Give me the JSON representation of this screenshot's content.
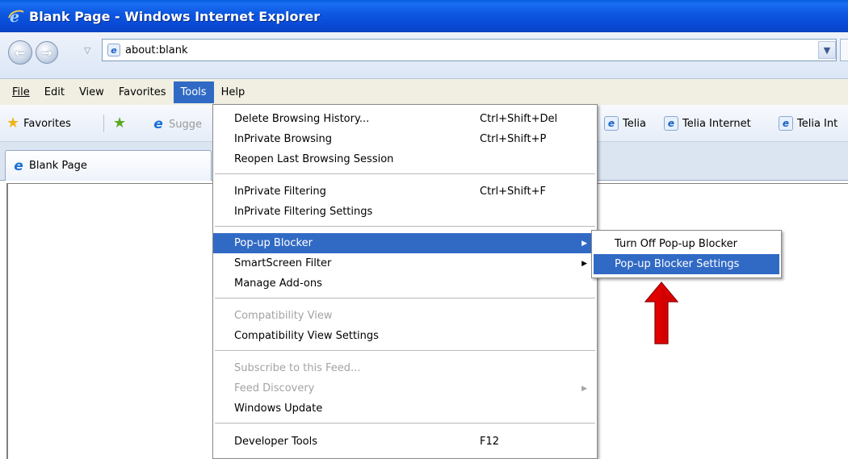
{
  "window": {
    "title": "Blank Page - Windows Internet Explorer"
  },
  "address": {
    "url": "about:blank"
  },
  "menubar": [
    "File",
    "Edit",
    "View",
    "Favorites",
    "Tools",
    "Help"
  ],
  "favorites_bar": {
    "favorites_label": "Favorites",
    "suggested_label": "Sugge",
    "links": [
      "Telia",
      "Telia Internet",
      "Telia Int"
    ]
  },
  "tab": {
    "label": "Blank Page"
  },
  "tools_menu": {
    "items": [
      {
        "label": "Delete Browsing History...",
        "shortcut": "Ctrl+Shift+Del"
      },
      {
        "label": "InPrivate Browsing",
        "shortcut": "Ctrl+Shift+P"
      },
      {
        "label": "Reopen Last Browsing Session",
        "shortcut": ""
      },
      {
        "label": "InPrivate Filtering",
        "shortcut": "Ctrl+Shift+F"
      },
      {
        "label": "InPrivate Filtering Settings",
        "shortcut": ""
      },
      {
        "label": "Pop-up Blocker",
        "shortcut": "",
        "highlighted": true,
        "submenu": true
      },
      {
        "label": "SmartScreen Filter",
        "shortcut": "",
        "submenu": true
      },
      {
        "label": "Manage Add-ons",
        "shortcut": ""
      },
      {
        "label": "Compatibility View",
        "shortcut": "",
        "disabled": true
      },
      {
        "label": "Compatibility View Settings",
        "shortcut": ""
      },
      {
        "label": "Subscribe to this Feed...",
        "shortcut": "",
        "disabled": true
      },
      {
        "label": "Feed Discovery",
        "shortcut": "",
        "disabled": true,
        "submenu": true
      },
      {
        "label": "Windows Update",
        "shortcut": ""
      },
      {
        "label": "Developer Tools",
        "shortcut": "F12"
      }
    ]
  },
  "popup_submenu": {
    "items": [
      {
        "label": "Turn Off Pop-up Blocker"
      },
      {
        "label": "Pop-up Blocker Settings",
        "highlighted": true
      }
    ]
  },
  "colors": {
    "highlight": "#316ac5",
    "titlebar": "#0a56e0",
    "arrow": "#e00000"
  }
}
